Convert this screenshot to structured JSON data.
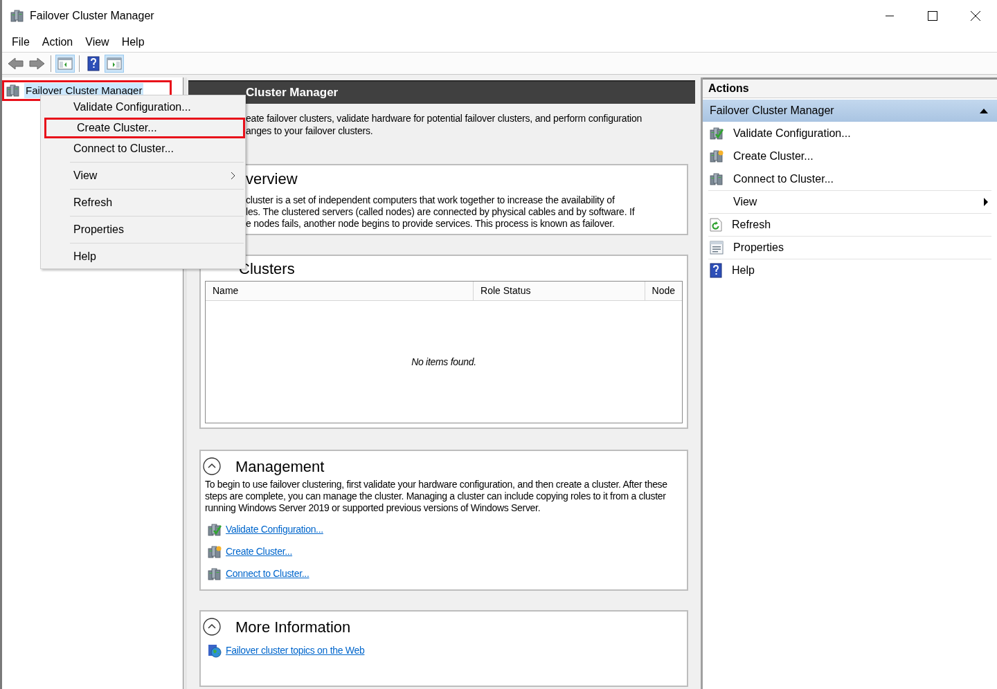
{
  "window": {
    "title": "Failover Cluster Manager"
  },
  "menu_bar": [
    "File",
    "Action",
    "View",
    "Help"
  ],
  "toolbar": [
    {
      "kind": "back",
      "pressed": false
    },
    {
      "kind": "forward",
      "pressed": false
    },
    {
      "kind": "separator"
    },
    {
      "kind": "tree-pane",
      "pressed": true
    },
    {
      "kind": "separator"
    },
    {
      "kind": "help",
      "pressed": false
    },
    {
      "kind": "action-pane",
      "pressed": true
    }
  ],
  "tree": {
    "items": [
      {
        "label": "Failover Cluster Manager",
        "highlighted": true
      }
    ]
  },
  "context_menu": {
    "items": [
      {
        "kind": "item",
        "label": "Validate Configuration...",
        "highlighted": false
      },
      {
        "kind": "item",
        "label": "Create Cluster...",
        "highlighted": true
      },
      {
        "kind": "item",
        "label": "Connect to Cluster...",
        "highlighted": false
      },
      {
        "kind": "separator"
      },
      {
        "kind": "submenu",
        "label": "View",
        "highlighted": false
      },
      {
        "kind": "separator"
      },
      {
        "kind": "item",
        "label": "Refresh",
        "highlighted": false
      },
      {
        "kind": "separator"
      },
      {
        "kind": "item",
        "label": "Properties",
        "highlighted": false
      },
      {
        "kind": "separator"
      },
      {
        "kind": "item",
        "label": "Help",
        "highlighted": false
      }
    ]
  },
  "main": {
    "header": "Cluster Manager",
    "description": [
      "eate failover clusters, validate hardware for potential failover clusters, and perform configuration",
      "anges to your failover clusters."
    ],
    "overview": {
      "title": "verview",
      "lines": [
        "cluster is a set of independent computers that work together to increase the availability of",
        "les. The clustered servers (called nodes) are connected by physical cables and by software. If",
        "e nodes fails, another node begins to provide services. This process is known as failover."
      ]
    },
    "clusters": {
      "title": "Clusters",
      "columns": [
        "Name",
        "Role Status",
        "Node"
      ],
      "empty_text": "No items found."
    },
    "management": {
      "title": "Management",
      "expanded": true,
      "text": "To begin to use failover clustering, first validate your hardware configuration, and then create a cluster. After these steps are complete, you can manage the cluster. Managing a cluster can include copying roles to it from a cluster running Windows Server 2019 or supported previous versions of Windows Server.",
      "links": [
        {
          "kind": "validate",
          "label": "Validate Configuration..."
        },
        {
          "kind": "create",
          "label": "Create Cluster..."
        },
        {
          "kind": "connect",
          "label": "Connect to Cluster..."
        }
      ]
    },
    "more_information": {
      "title": "More Information",
      "expanded": true,
      "links": [
        {
          "kind": "web",
          "label": "Failover cluster topics on the Web"
        }
      ]
    }
  },
  "actions": {
    "title": "Actions",
    "section": {
      "title": "Failover Cluster Manager",
      "expanded": true
    },
    "items": [
      {
        "kind": "validate",
        "label": "Validate Configuration..."
      },
      {
        "kind": "create",
        "label": "Create Cluster..."
      },
      {
        "kind": "connect",
        "label": "Connect to Cluster..."
      },
      {
        "kind": "view",
        "label": "View"
      },
      {
        "kind": "refresh",
        "label": "Refresh"
      },
      {
        "kind": "properties",
        "label": "Properties"
      },
      {
        "kind": "help",
        "label": "Help"
      }
    ]
  }
}
